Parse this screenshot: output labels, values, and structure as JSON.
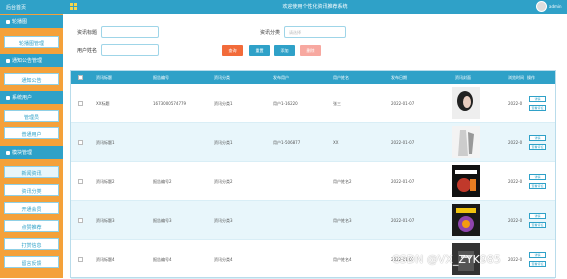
{
  "topbar": {
    "title": "欢迎使用个性化资讯推荐系统",
    "user": "admin"
  },
  "sidebar": {
    "home": "后台首页",
    "groups": [
      {
        "label": "轮播图",
        "items": [
          "轮播图管理"
        ]
      },
      {
        "label": "通知公告管理",
        "items": [
          "通知公告"
        ]
      },
      {
        "label": "系统用户",
        "items": [
          "管理员",
          "普通用户"
        ]
      },
      {
        "label": "模块管理",
        "items": [
          "新闻资讯",
          "资讯分类",
          "开通会员",
          "点赞推荐",
          "打赏信息",
          "留言反馈"
        ]
      }
    ]
  },
  "filters": {
    "title_label": "资讯标题",
    "category_label": "资讯分类",
    "category_placeholder": "请选择",
    "user_label": "用户姓名",
    "buttons": [
      "查询",
      "重置",
      "添加",
      "删除"
    ]
  },
  "table": {
    "headers": [
      "资讯标题",
      "报告编号",
      "资讯分类",
      "发布用户",
      "用户姓名",
      "发布日期",
      "资讯封面",
      "浏览时间",
      "操作"
    ],
    "rows": [
      {
        "title": "XX标题",
        "code": "1673000574779",
        "category": "资讯分类1",
        "user": "用户1-16220",
        "name": "张三",
        "date": "2022-01-07",
        "time": "2022-0"
      },
      {
        "title": "资讯标题1",
        "code": "",
        "category": "资讯分类1",
        "user": "用户1-506877",
        "name": "XX",
        "date": "2022-01-07",
        "time": "2022-0"
      },
      {
        "title": "资讯标题2",
        "code": "报告编号2",
        "category": "资讯分类2",
        "user": "",
        "name": "用户姓名2",
        "date": "2022-01-07",
        "time": "2022-0"
      },
      {
        "title": "资讯标题3",
        "code": "报告编号3",
        "category": "资讯分类3",
        "user": "",
        "name": "用户姓名3",
        "date": "2022-01-07",
        "time": "2022-0"
      },
      {
        "title": "资讯标题4",
        "code": "报告编号4",
        "category": "资讯分类4",
        "user": "",
        "name": "用户姓名4",
        "date": "2022-01-07",
        "time": "2022-0"
      }
    ],
    "action_edit": "详情",
    "action_view": "查看评论"
  },
  "watermark": "CSDN @VX_ZYK985",
  "colors": {
    "primary": "#2fa1c8",
    "sidebar": "#f4a13a",
    "query": "#f26b3a",
    "reset": "#2fa1c8",
    "add": "#2fa1c8",
    "delete": "#f7a8a0"
  }
}
